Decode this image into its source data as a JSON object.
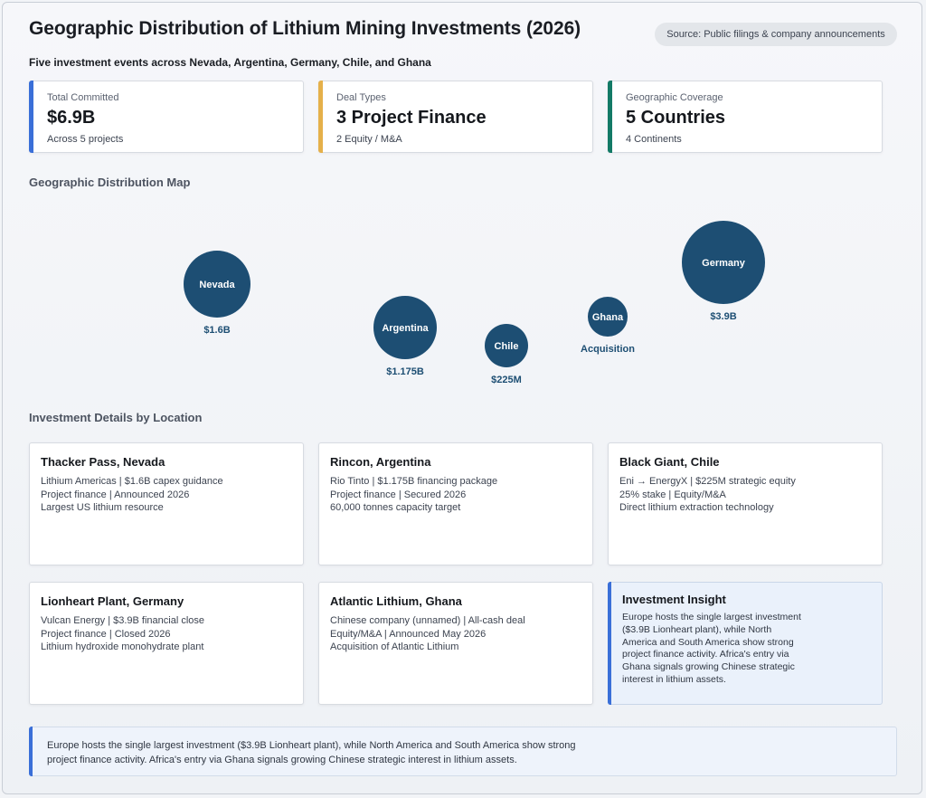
{
  "header": {
    "title": "Geographic Distribution of Lithium Mining Investments (2026)",
    "source": "Source: Public filings & company announcements",
    "subtitle": "Five investment events across Nevada, Argentina, Germany, Chile, and Ghana"
  },
  "stats": [
    {
      "label": "Total Committed",
      "value": "$6.9B",
      "sub": "Across 5 projects",
      "accent": "#3a6fd8"
    },
    {
      "label": "Deal Types",
      "value": "3 Project Finance",
      "sub": "2 Equity / M&A",
      "accent": "#e5b04a"
    },
    {
      "label": "Geographic Coverage",
      "value": "5 Countries",
      "sub": "4 Continents",
      "accent": "#137a66"
    }
  ],
  "sections": {
    "map_title": "Geographic Distribution Map",
    "details_title": "Investment Details by Location"
  },
  "chart_data": {
    "type": "bubble-map",
    "bubble_color": "#1d4e73",
    "label_color": "#1d4e73",
    "points": [
      {
        "name": "Nevada",
        "value_usd_m": 1600,
        "label": "$1.6B"
      },
      {
        "name": "Argentina",
        "value_usd_m": 1175,
        "label": "$1.175B"
      },
      {
        "name": "Chile",
        "value_usd_m": 225,
        "label": "$225M"
      },
      {
        "name": "Ghana",
        "value_usd_m": null,
        "label": "Acquisition"
      },
      {
        "name": "Germany",
        "value_usd_m": 3900,
        "label": "$3.9B"
      }
    ]
  },
  "details": [
    {
      "title": "Thacker Pass, Nevada",
      "lines": [
        "Lithium Americas | $1.6B capex guidance",
        "Project finance | Announced 2026",
        "Largest US lithium resource"
      ]
    },
    {
      "title": "Rincon, Argentina",
      "lines": [
        "Rio Tinto | $1.175B financing package",
        "Project finance | Secured 2026",
        "60,000 tonnes capacity target"
      ]
    },
    {
      "title": "Black Giant, Chile",
      "lines": [
        "Eni → EnergyX | $225M strategic equity",
        "25% stake | Equity/M&A",
        "Direct lithium extraction technology"
      ]
    },
    {
      "title": "Lionheart Plant, Germany",
      "lines": [
        "Vulcan Energy | $3.9B financial close",
        "Project finance | Closed 2026",
        "Lithium hydroxide monohydrate plant"
      ]
    },
    {
      "title": "Atlantic Lithium, Ghana",
      "lines": [
        "Chinese company (unnamed) | All-cash deal",
        "Equity/M&A | Announced May 2026",
        "Acquisition of Atlantic Lithium"
      ]
    }
  ],
  "insight": {
    "title": "Investment Insight",
    "text": "Europe hosts the single largest investment ($3.9B Lionheart plant), while North America and South America show strong project finance activity. Africa's entry via Ghana signals growing Chinese strategic interest in lithium assets."
  },
  "footer": {
    "text": "Europe hosts the single largest investment ($3.9B Lionheart plant), while North America and South America show strong project finance activity. Africa's entry via Ghana signals growing Chinese strategic interest in lithium assets."
  }
}
